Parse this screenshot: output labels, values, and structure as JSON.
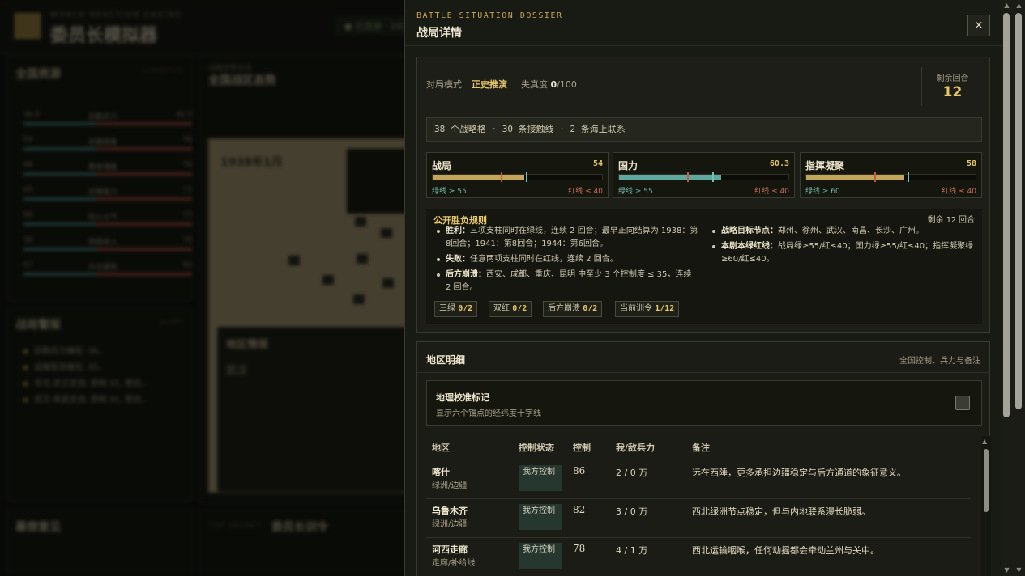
{
  "background": {
    "brand_sub": "WORLD REACTION ENGINE",
    "brand_title": "委员长模拟器",
    "status_pill": "● 已连接 · 1938",
    "resources_title": "全国资源",
    "resources_sub": "LOGISTICS",
    "resource_rows": [
      {
        "a": "36.5",
        "b": "后勤兵力",
        "c": "42.5"
      },
      {
        "a": "54",
        "b": "武器装备",
        "c": "76"
      },
      {
        "a": "66",
        "b": "粮食储备",
        "c": "76"
      },
      {
        "a": "45",
        "b": "运输能力",
        "c": "73"
      },
      {
        "a": "66",
        "b": "民心士气",
        "c": "73"
      },
      {
        "a": "58",
        "b": "财政收入",
        "c": "76"
      },
      {
        "a": "57",
        "b": "外交援助",
        "c": "82"
      }
    ],
    "alert_title": "战局警报",
    "alert_sub": "ALERT",
    "alerts": [
      "后勤兵力偏低: 36。",
      "运输瓶颈偏低: 45。",
      "华北-武汉支线, 损耗 91, 稳住。",
      "武汉-南昌支线, 损耗 91, 稳住。"
    ],
    "map_kicker": "战略态势总览",
    "map_title": "全国战区态势",
    "map_date": "1938年1月",
    "region_title": "地区情报",
    "region_name": "武汉",
    "secret_label": "TOP SECRET",
    "decree_title": "委员长训令",
    "notes_title": "幕僚意见"
  },
  "drawer": {
    "kicker": "BATTLE SITUATION DOSSIER",
    "title": "战局详情",
    "close_label": "×",
    "mode_label": "对局模式",
    "mode_value": "正史推演",
    "distortion_label": "失真度",
    "distortion_value": "0",
    "distortion_max": "/100",
    "rounds_label": "剩余回合",
    "rounds_value": "12",
    "summary": "38 个战略格 · 30 条接触线 · 2 条海上联系",
    "meters": [
      {
        "name": "战局",
        "value": "54",
        "value_num": 54,
        "green": "绿线 ≥ 55",
        "red": "红线 ≤ 40",
        "red_at": 40,
        "green_at": 55,
        "color": "#c2a55a"
      },
      {
        "name": "国力",
        "value": "60.3",
        "value_num": 60.3,
        "green": "绿线 ≥ 55",
        "red": "红线 ≤ 40",
        "red_at": 40,
        "green_at": 55,
        "color": "#5fa8a0"
      },
      {
        "name": "指挥凝聚",
        "value": "58",
        "value_num": 58,
        "green": "绿线 ≥ 60",
        "red": "红线 ≤ 40",
        "red_at": 40,
        "green_at": 60,
        "color": "#c2a55a"
      }
    ],
    "rules": {
      "title": "公开胜负规则",
      "left_label": "剩余",
      "left_value": "12",
      "left_unit": "回合",
      "items_left": [
        {
          "head": "胜利：",
          "text": "三项支柱同时在绿线，连续 2 回合；最早正向结算为 1938：第8回合；1941：第8回合；1944：第6回合。"
        },
        {
          "head": "失败：",
          "text": "任意两项支柱同时在红线，连续 2 回合。"
        },
        {
          "head": "后方崩溃：",
          "text": "西安、成都、重庆、昆明 中至少 3 个控制度 ≤ 35，连续 2 回合。"
        }
      ],
      "items_right": [
        {
          "head": "战略目标节点：",
          "text": "郑州、徐州、武汉、南昌、长沙、广州。"
        },
        {
          "head": "本剧本绿红线：",
          "text": "战局绿≥55/红≤40；国力绿≥55/红≤40；指挥凝聚绿≥60/红≤40。"
        }
      ],
      "chips": [
        {
          "label": "三绿",
          "value": "0/2"
        },
        {
          "label": "双红",
          "value": "0/2"
        },
        {
          "label": "后方崩溃",
          "value": "0/2"
        },
        {
          "label": "当前训令",
          "value": "1/12"
        }
      ]
    },
    "regions": {
      "title": "地区明细",
      "subtitle": "全国控制、兵力与备注",
      "calib_title": "地理校准标记",
      "calib_sub": "显示六个锚点的经纬度十字线",
      "headers": {
        "region": "地区",
        "status": "控制状态",
        "control": "控制",
        "force": "我/敌兵力",
        "note": "备注"
      },
      "rows": [
        {
          "name": "喀什",
          "type": "绿洲/边疆",
          "status": "我方控制",
          "control": "86",
          "force": "2 / 0 万",
          "note": "远在西陲，更多承担边疆稳定与后方通道的象征意义。"
        },
        {
          "name": "乌鲁木齐",
          "type": "绿洲/边疆",
          "status": "我方控制",
          "control": "82",
          "force": "3 / 0 万",
          "note": "西北绿洲节点稳定，但与内地联系漫长脆弱。"
        },
        {
          "name": "河西走廊",
          "type": "走廊/补给线",
          "status": "我方控制",
          "control": "78",
          "force": "4 / 1 万",
          "note": "西北运输咽喉，任何动摇都会牵动兰州与关中。"
        }
      ]
    }
  },
  "colors": {
    "accent": "#e6c66a",
    "green_line": "#6fb0a5",
    "red_line": "#c66a5a",
    "controlled_badge": "#26372f"
  }
}
